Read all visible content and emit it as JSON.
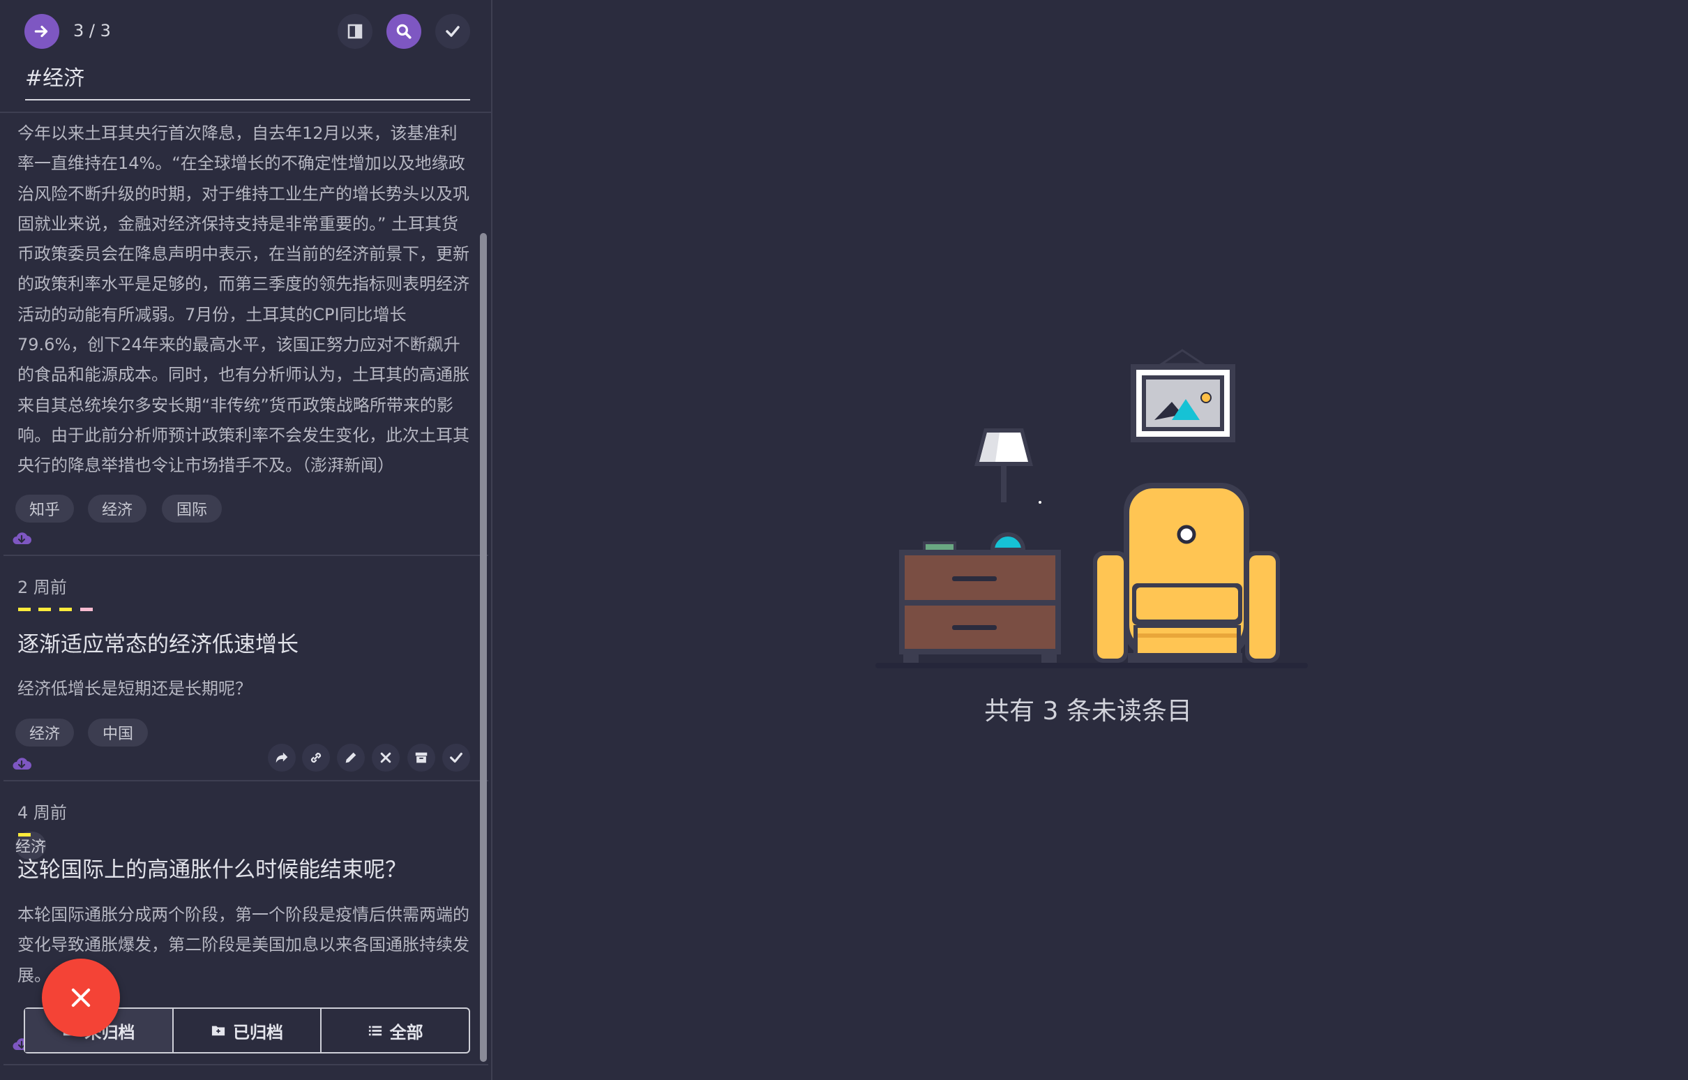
{
  "header": {
    "counter": "3 / 3",
    "search_value": "#经济"
  },
  "items": [
    {
      "body": "今年以来土耳其央行首次降息，自去年12月以来，该基准利率一直维持在14%。“在全球增长的不确定性增加以及地缘政治风险不断升级的时期，对于维持工业生产的增长势头以及巩固就业来说，金融对经济保持支持是非常重要的。” 土耳其货币政策委员会在降息声明中表示，在当前的经济前景下，更新的政策利率水平是足够的，而第三季度的领先指标则表明经济活动的动能有所减弱。7月份，土耳其的CPI同比增长79.6%，创下24年来的最高水平，该国正努力应对不断飙升的食品和能源成本。同时，也有分析师认为，土耳其的高通胀来自其总统埃尔多安长期“非传统”货币政策战略所带来的影响。由于此前分析师预计政策利率不会发生变化，此次土耳其央行的降息举措也令让市场措手不及。（澎湃新闻）",
      "tags": [
        "知乎",
        "经济",
        "国际"
      ]
    },
    {
      "time": "2 周前",
      "title": "逐渐适应常态的经济低速增长",
      "summary": "经济低增长是短期还是长期呢？",
      "tags": [
        "经济",
        "中国"
      ]
    },
    {
      "time": "4 周前",
      "title": "这轮国际上的高通胀什么时候能结束呢？",
      "summary": "本轮国际通胀分成两个阶段，第一个阶段是疫情后供需两端的变化导致通胀爆发，第二阶段是美国加息以来各国通胀持续发展。"
    }
  ],
  "colors": {
    "accent": "#7e57c2",
    "yellow_bar": "#ffeb3b",
    "pink_bar": "#f8bbd0",
    "fab": "#f44336"
  },
  "filters": {
    "unarchived": "未归档",
    "archived": "已归档",
    "all": "全部"
  },
  "empty_state": {
    "text": "共有 3 条未读条目"
  }
}
